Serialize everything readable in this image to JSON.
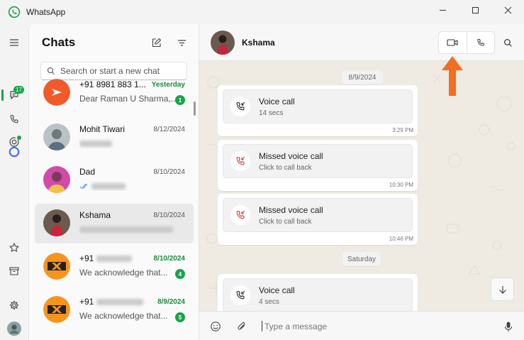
{
  "window": {
    "title": "WhatsApp"
  },
  "rail": {
    "chats_badge": "17"
  },
  "chats_panel": {
    "title": "Chats",
    "search_placeholder": "Search or start a new chat",
    "items": [
      {
        "name": "+91 8981 883 1...",
        "date": "Yesterday",
        "preview": "Dear Raman U Sharma,...",
        "unread": "1",
        "avatar": "red"
      },
      {
        "name": "Mohit Tiwari",
        "date": "8/12/2024",
        "preview": "",
        "unread": "",
        "avatar": "photo"
      },
      {
        "name": "Dad",
        "date": "8/10/2024",
        "preview": "",
        "unread": "",
        "avatar": "pink"
      },
      {
        "name": "Kshama",
        "date": "8/10/2024",
        "preview": "",
        "unread": "",
        "avatar": "kshama"
      },
      {
        "name": "+91",
        "date": "8/10/2024",
        "preview": "We acknowledge that...",
        "unread": "4",
        "avatar": "orange"
      },
      {
        "name": "+91",
        "date": "8/9/2024",
        "preview": "We acknowledge that...",
        "unread": "5",
        "avatar": "orange"
      }
    ]
  },
  "conversation": {
    "contact_name": "Kshama",
    "date_chips": [
      "8/9/2024",
      "Saturday"
    ],
    "messages": [
      {
        "title": "Voice call",
        "subtitle": "14 secs",
        "time": "3:29 PM",
        "missed": false
      },
      {
        "title": "Missed voice call",
        "subtitle": "Click to call back",
        "time": "10:30 PM",
        "missed": true
      },
      {
        "title": "Missed voice call",
        "subtitle": "Click to call back",
        "time": "10:46 PM",
        "missed": true
      },
      {
        "title": "Voice call",
        "subtitle": "4 secs",
        "time": "",
        "missed": false
      }
    ],
    "composer_placeholder": "Type a message"
  },
  "colors": {
    "accent": "#1aa34a",
    "arrow": "#f26f21",
    "missed": "#d33c3c"
  }
}
